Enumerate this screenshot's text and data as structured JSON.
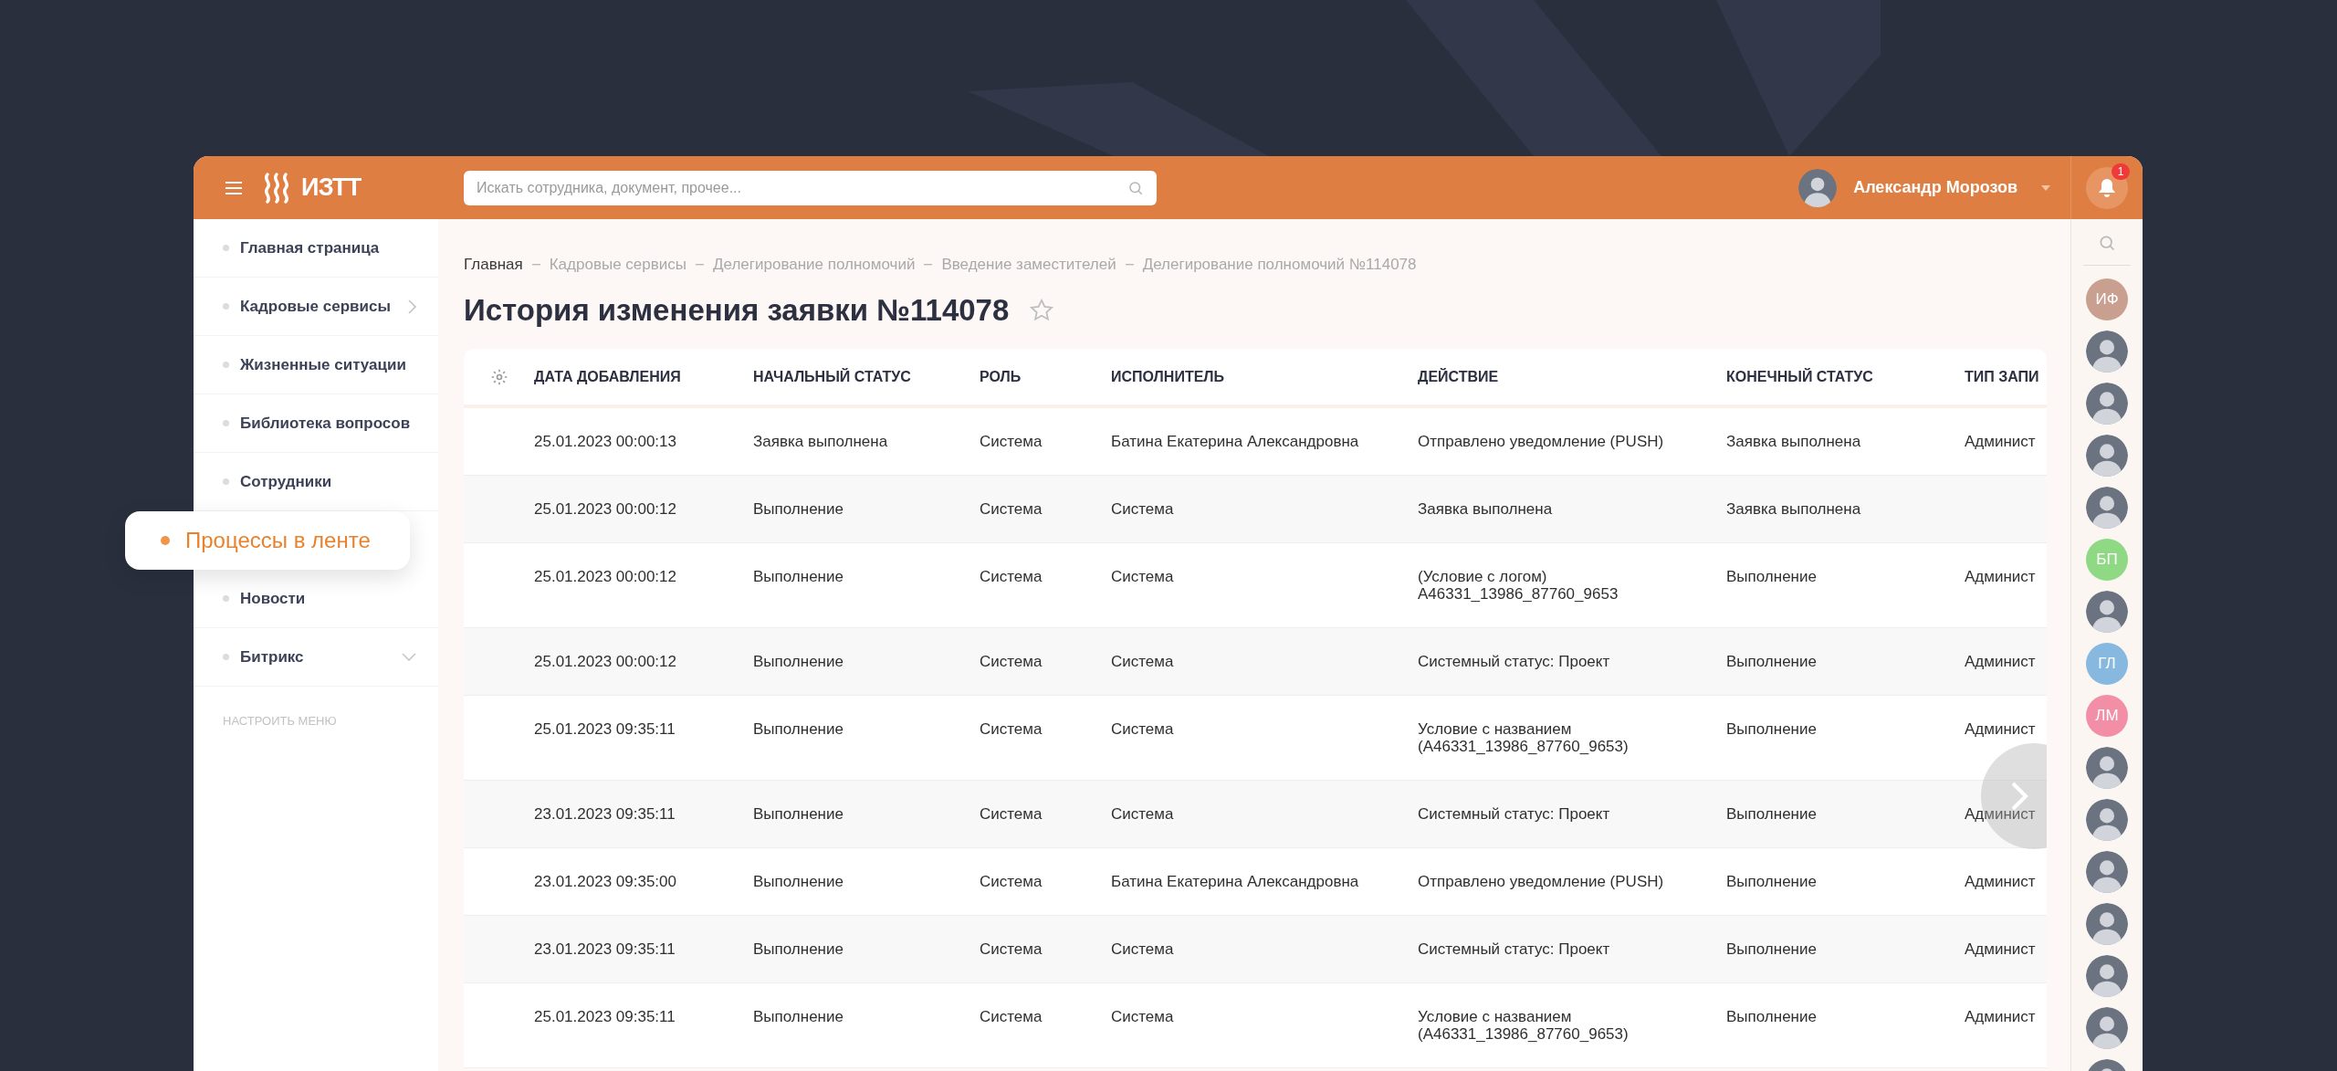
{
  "header": {
    "logo": "ИЗТТ",
    "search": {
      "placeholder": "Искать сотрудника, документ, прочее..."
    },
    "user": {
      "name": "Александр Морозов"
    },
    "notifications": {
      "count": "1"
    }
  },
  "sidebar": {
    "items": [
      {
        "label": "Главная страница",
        "selected": false,
        "kind": "link"
      },
      {
        "label": "Кадровые сервисы",
        "selected": false,
        "kind": "submenu"
      },
      {
        "label": "Жизненные ситуации",
        "selected": false,
        "kind": "link"
      },
      {
        "label": "Библиотека вопросов",
        "selected": false,
        "kind": "link"
      },
      {
        "label": "Сотрудники",
        "selected": false,
        "kind": "link"
      },
      {
        "label": "Процессы в ленте",
        "selected": true,
        "kind": "link"
      },
      {
        "label": "Новости",
        "selected": false,
        "kind": "link"
      },
      {
        "label": "Битрикс",
        "selected": false,
        "kind": "dropdown"
      }
    ],
    "settings_link": "НАСТРОИТЬ МЕНЮ"
  },
  "breadcrumbs": [
    "Главная",
    "Кадровые сервисы",
    "Делегирование полномочий",
    "Введение заместителей",
    "Делегирование полномочий №114078"
  ],
  "page_title": "История изменения заявки №114078",
  "table": {
    "columns": [
      "ДАТА ДОБАВЛЕНИЯ",
      "НАЧАЛЬНЫЙ СТАТУС",
      "РОЛЬ",
      "ИСПОЛНИТЕЛЬ",
      "ДЕЙСТВИЕ",
      "КОНЕЧНЫЙ СТАТУС",
      "ТИП ЗАПИ"
    ],
    "rows": [
      [
        "25.01.2023 00:00:13",
        "Заявка выполнена",
        "Система",
        "Батина Екатерина Александровна",
        "Отправлено уведомление (PUSH)",
        "Заявка выполнена",
        "Админист"
      ],
      [
        "25.01.2023 00:00:12",
        "Выполнение",
        "Система",
        "Система",
        "Заявка выполнена",
        "Заявка выполнена",
        ""
      ],
      [
        "25.01.2023 00:00:12",
        "Выполнение",
        "Система",
        "Система",
        "(Условие с логом)\nА46331_13986_87760_9653",
        "Выполнение",
        "Админист"
      ],
      [
        "25.01.2023 00:00:12",
        "Выполнение",
        "Система",
        "Система",
        "Системный статус: Проект",
        "Выполнение",
        "Админист"
      ],
      [
        "25.01.2023 09:35:11",
        "Выполнение",
        "Система",
        "Система",
        "Условие с названием\n(А46331_13986_87760_9653)",
        "Выполнение",
        "Админист"
      ],
      [
        "23.01.2023 09:35:11",
        "Выполнение",
        "Система",
        "Система",
        "Системный статус: Проект",
        "Выполнение",
        "Админист"
      ],
      [
        "23.01.2023 09:35:00",
        "Выполнение",
        "Система",
        "Батина Екатерина Александровна",
        "Отправлено уведомление (PUSH)",
        "Выполнение",
        "Админист"
      ],
      [
        "23.01.2023 09:35:11",
        "Выполнение",
        "Система",
        "Система",
        "Системный статус: Проект",
        "Выполнение",
        "Админист"
      ],
      [
        "25.01.2023 09:35:11",
        "Выполнение",
        "Система",
        "Система",
        "Условие с названием\n(А46331_13986_87760_9653)",
        "Выполнение",
        "Админист"
      ]
    ]
  },
  "contacts": [
    {
      "kind": "initials",
      "text": "ИФ",
      "color": "#c9a08f"
    },
    {
      "kind": "photo"
    },
    {
      "kind": "photo"
    },
    {
      "kind": "photo"
    },
    {
      "kind": "photo"
    },
    {
      "kind": "initials",
      "text": "БП",
      "color": "#8fd884"
    },
    {
      "kind": "photo"
    },
    {
      "kind": "initials",
      "text": "ГЛ",
      "color": "#86b8e0"
    },
    {
      "kind": "initials",
      "text": "ЛМ",
      "color": "#f28fa6"
    },
    {
      "kind": "photo"
    },
    {
      "kind": "photo"
    },
    {
      "kind": "photo"
    },
    {
      "kind": "photo"
    },
    {
      "kind": "photo"
    },
    {
      "kind": "photo"
    },
    {
      "kind": "photo"
    }
  ]
}
